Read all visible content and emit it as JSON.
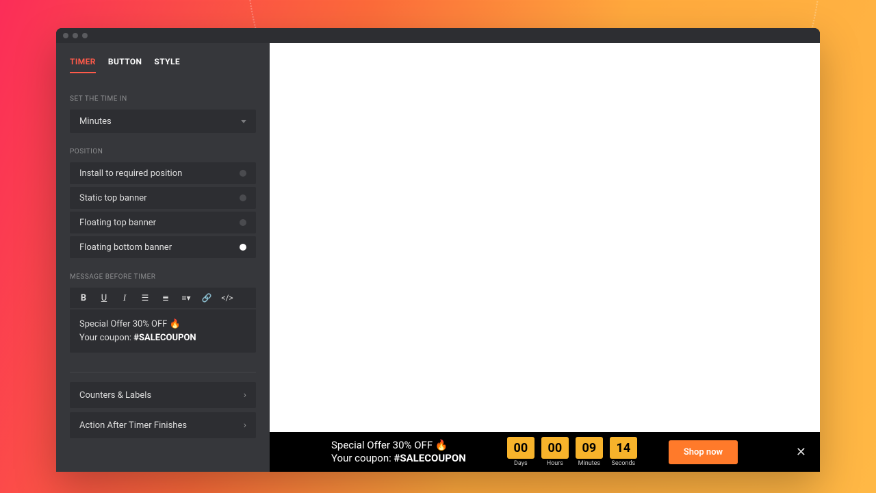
{
  "tabs": [
    "TIMER",
    "BUTTON",
    "STYLE"
  ],
  "active_tab_index": 0,
  "time_in": {
    "label": "SET THE TIME IN",
    "value": "Minutes"
  },
  "position": {
    "label": "POSITION",
    "options": [
      "Install to required position",
      "Static top banner",
      "Floating top banner",
      "Floating bottom banner"
    ],
    "selected_index": 3
  },
  "message": {
    "label": "MESSAGE BEFORE TIMER",
    "line1": "Special Offer 30% OFF 🔥",
    "line2_prefix": "Your coupon: ",
    "coupon": "#SALECOUPON"
  },
  "accordion1": "Counters & Labels",
  "accordion2": "Action After Timer Finishes",
  "preview": {
    "msg_line1": "Special Offer 30% OFF 🔥",
    "msg_line2_prefix": "Your coupon: ",
    "coupon": "#SALECOUPON",
    "timer": {
      "days": {
        "value": "00",
        "label": "Days"
      },
      "hours": {
        "value": "00",
        "label": "Hours"
      },
      "minutes": {
        "value": "09",
        "label": "Minutes"
      },
      "seconds": {
        "value": "14",
        "label": "Seconds"
      }
    },
    "cta": "Shop now"
  }
}
